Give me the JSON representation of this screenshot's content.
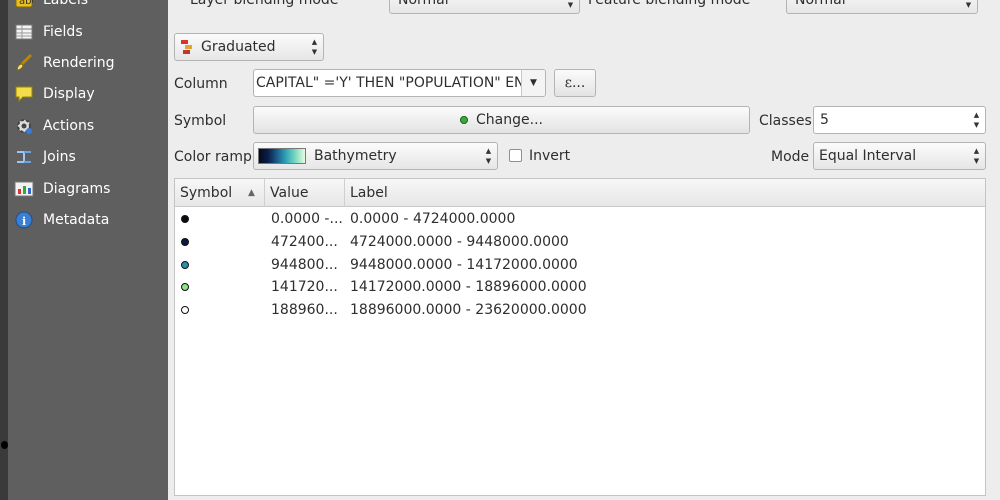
{
  "sidebar": {
    "items": [
      {
        "label": "Labels",
        "icon": "labels-icon"
      },
      {
        "label": "Fields",
        "icon": "fields-icon"
      },
      {
        "label": "Rendering",
        "icon": "rendering-brush-icon"
      },
      {
        "label": "Display",
        "icon": "display-speech-icon"
      },
      {
        "label": "Actions",
        "icon": "actions-gear-icon"
      },
      {
        "label": "Joins",
        "icon": "joins-icon"
      },
      {
        "label": "Diagrams",
        "icon": "diagrams-icon"
      },
      {
        "label": "Metadata",
        "icon": "metadata-info-icon"
      }
    ]
  },
  "blending": {
    "layer_label": "Layer blending mode",
    "layer_value": "Normal",
    "feature_label": "Feature blending mode",
    "feature_value": "Normal"
  },
  "renderer": {
    "type_value": "Graduated",
    "column_label": "Column",
    "column_value": "CAPITAL\" ='Y' THEN \"POPULATION\" END",
    "expression_button": "ε...",
    "symbol_label": "Symbol",
    "change_button": "Change...",
    "classes_label": "Classes",
    "classes_value": "5",
    "color_ramp_label": "Color ramp",
    "color_ramp_value": "Bathymetry",
    "invert_label": "Invert",
    "invert_checked": false,
    "mode_label": "Mode",
    "mode_value": "Equal Interval"
  },
  "table": {
    "headers": {
      "symbol": "Symbol",
      "value": "Value",
      "label": "Label"
    },
    "sort_indicator": "▲",
    "rows": [
      {
        "value": "0.0000 -...",
        "label": "0.0000 - 4724000.0000",
        "color": "#0a0a14"
      },
      {
        "value": "472400...",
        "label": "4724000.0000 - 9448000.0000",
        "color": "#0b1b3d"
      },
      {
        "value": "944800...",
        "label": "9448000.0000 - 14172000.0000",
        "color": "#2a8ea8"
      },
      {
        "value": "141720...",
        "label": "14172000.0000 - 18896000.0000",
        "color": "#8ee08a"
      },
      {
        "value": "188960...",
        "label": "18896000.0000 - 23620000.0000",
        "color": "#ffffff"
      }
    ]
  },
  "colors": {
    "sidebar_bg": "#5f5f5f",
    "panel_bg": "#ededed",
    "change_symbol_dot": "#3aaa3a"
  }
}
